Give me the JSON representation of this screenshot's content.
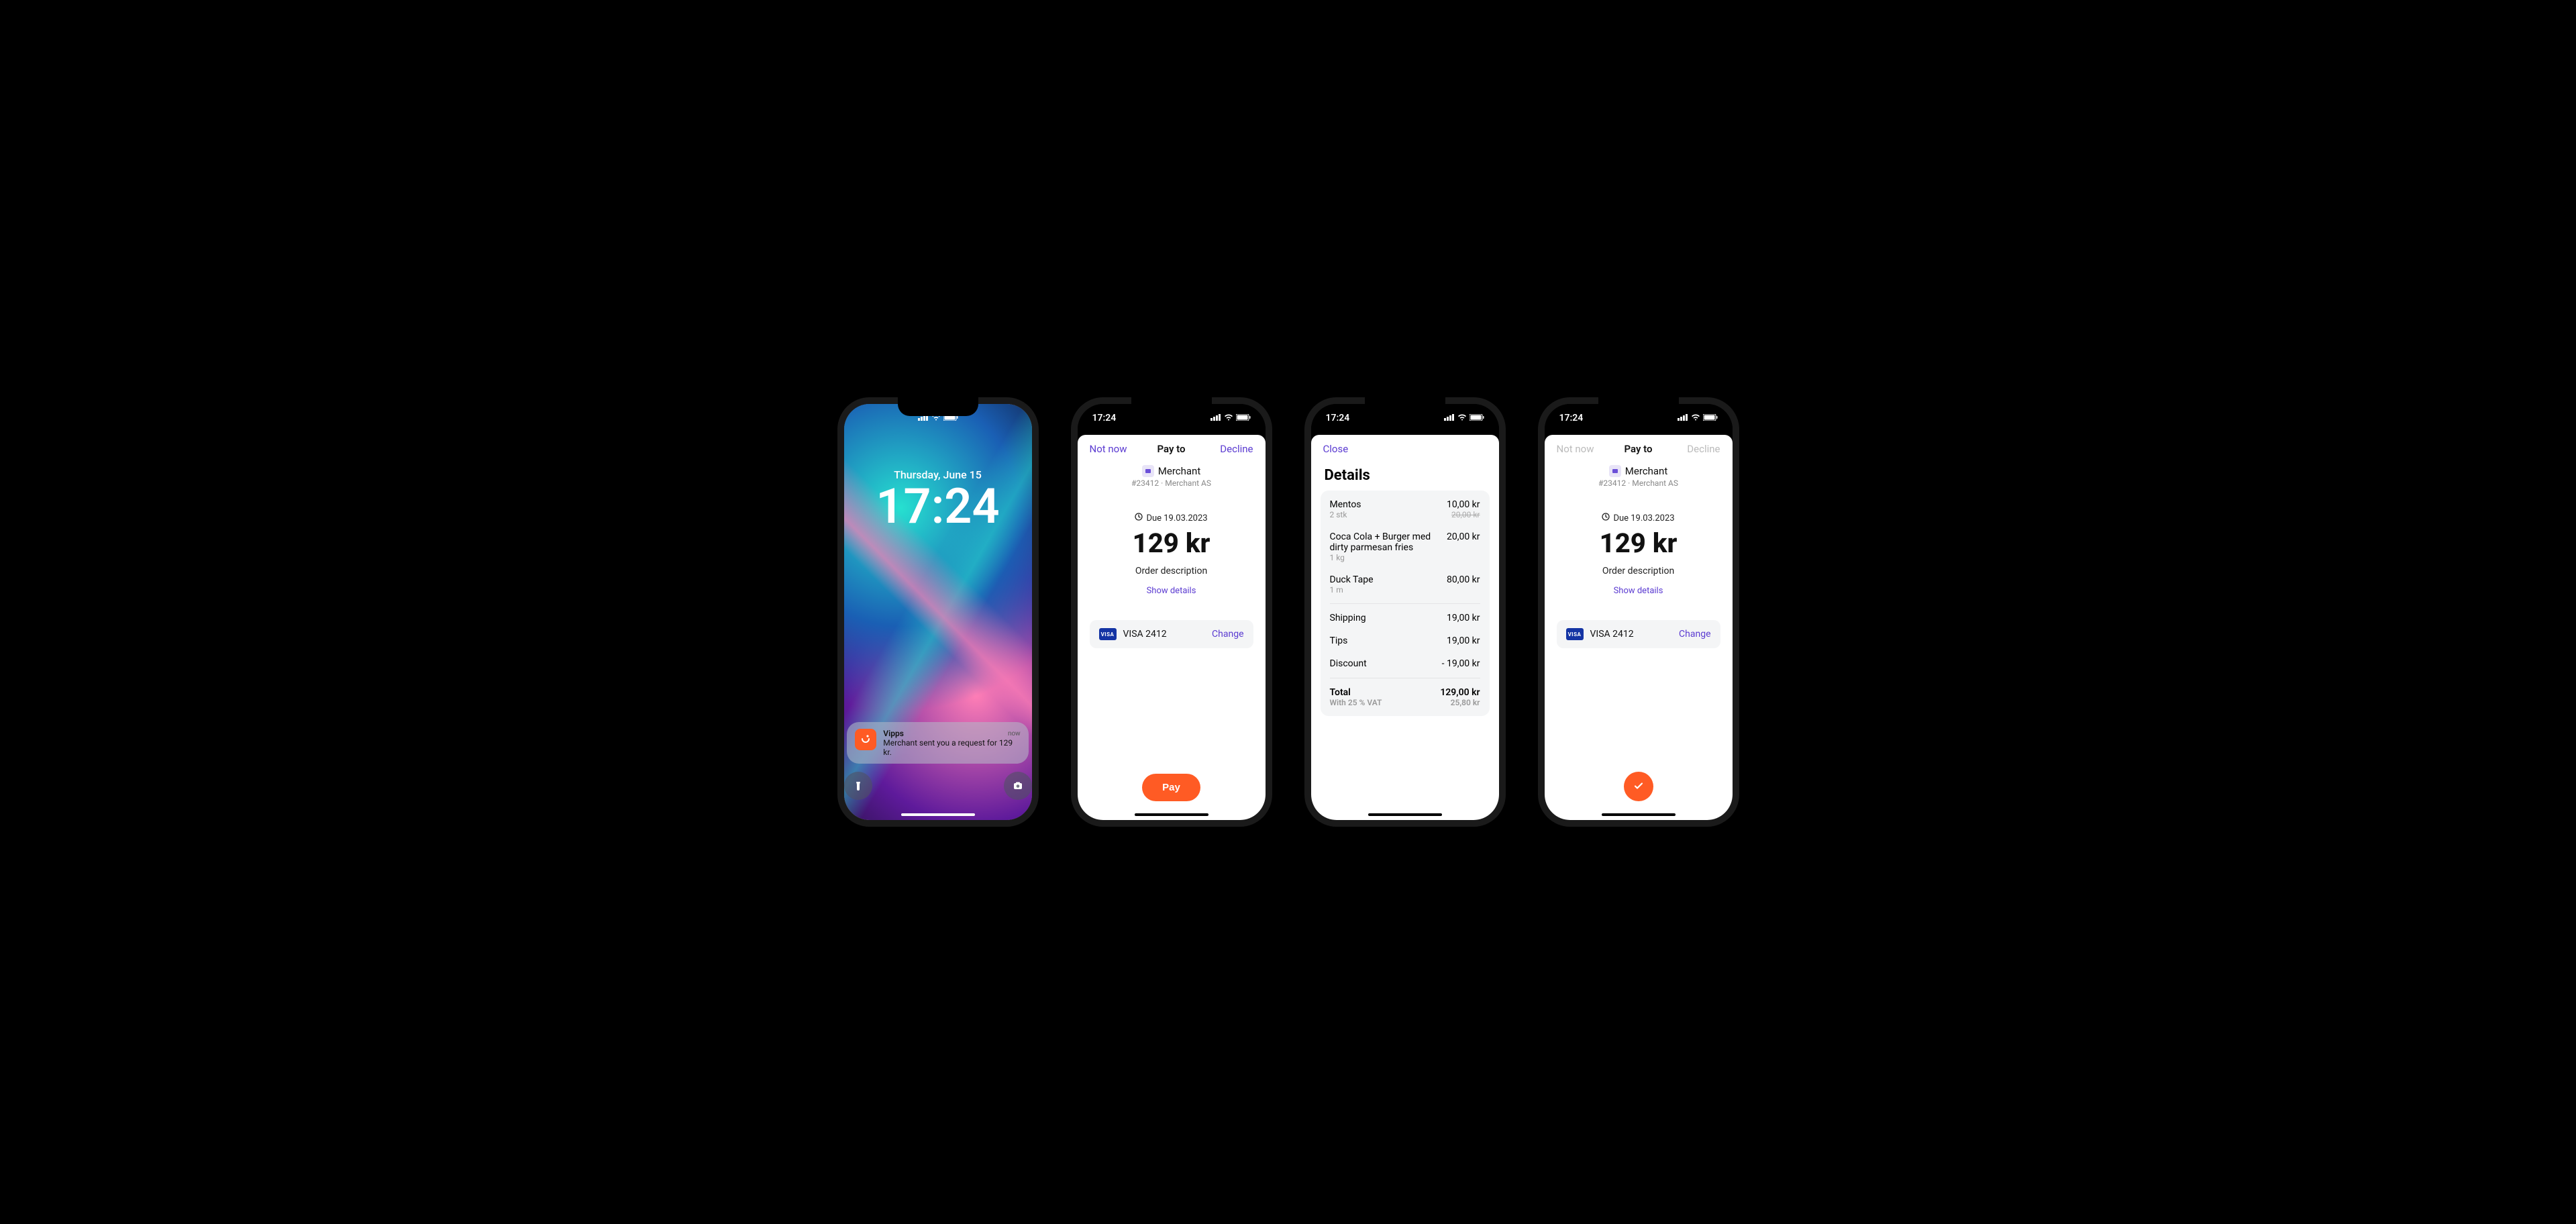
{
  "status_time": "17:24",
  "lock": {
    "date": "Thursday, June 15",
    "time": "17:24",
    "notif_app": "Vipps",
    "notif_time": "now",
    "notif_body": "Merchant sent you a request for 129 kr."
  },
  "pay": {
    "nav_left": "Not now",
    "nav_title": "Pay to",
    "nav_right": "Decline",
    "merchant": "Merchant",
    "merchant_sub": "#23412 · Merchant AS",
    "due": "Due 19.03.2023",
    "amount": "129 kr",
    "order_desc": "Order description",
    "show_details": "Show details",
    "card": "VISA 2412",
    "visa": "VISA",
    "change": "Change",
    "pay_label": "Pay"
  },
  "details": {
    "close": "Close",
    "title": "Details",
    "items": [
      {
        "name": "Mentos",
        "qty": "2 stk",
        "price": "10,00 kr",
        "original": "20,00 kr"
      },
      {
        "name": "Coca Cola + Burger med dirty parmesan fries",
        "qty": "1 kg",
        "price": "20,00 kr"
      },
      {
        "name": "Duck Tape",
        "qty": "1 m",
        "price": "80,00 kr"
      }
    ],
    "shipping_label": "Shipping",
    "shipping": "19,00 kr",
    "tips_label": "Tips",
    "tips": "19,00 kr",
    "discount_label": "Discount",
    "discount": "- 19,00 kr",
    "total_label": "Total",
    "total": "129,00 kr",
    "vat_label": "With 25 % VAT",
    "vat": "25,80 kr"
  }
}
